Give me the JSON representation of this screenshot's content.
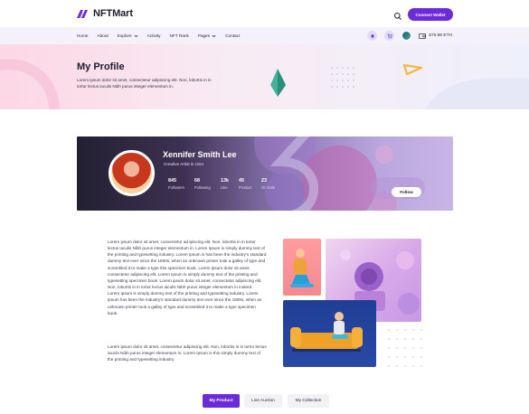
{
  "brand": {
    "name": "NFTMart",
    "accent": "#6c2bd9"
  },
  "header": {
    "connect_label": "Connect Wallet",
    "search_icon": "search-icon"
  },
  "nav": {
    "links": [
      {
        "label": "Home"
      },
      {
        "label": "About"
      },
      {
        "label": "Explore",
        "dropdown": true
      },
      {
        "label": "Activity"
      },
      {
        "label": "NFT Rank"
      },
      {
        "label": "Pages",
        "dropdown": true
      },
      {
        "label": "Contact"
      }
    ],
    "balance": "675.86 ETH"
  },
  "hero": {
    "title": "My Profile",
    "description": "Lorem ipsum dolor sit amet, consectetur adipiscing elit. Non, lobortis in in tortor lectus iaculis Nibh purus integer elementum in."
  },
  "profile": {
    "name": "Xennifer Smith Lee",
    "role": "Creative Artist in USA",
    "stats": [
      {
        "value": "845",
        "label": "Followers"
      },
      {
        "value": "68",
        "label": "Following"
      },
      {
        "value": "13k",
        "label": "Like"
      },
      {
        "value": "45",
        "label": "Product"
      },
      {
        "value": "23",
        "label": "On Sale"
      }
    ],
    "follow_label": "Follow"
  },
  "content": {
    "paragraph1": "Lorem ipsum dolor sit amet, consectetur ad-ipiscing elit. Non, lobortis in in tortor lectus iaculis Nibh purus integer elementum in. Lorem Ipsum is simply dummy text of the printing and typesetting industry. Lorem Ipsum is has been the industry's standard dummy text ever since the 1500s, when an unknown printer took a galley of type and scrambled it to make a type this specimen book. Lorem ipsum dolor sit amet, consectetur adipiscing elit. Lorem Ipsum is simply dummy text of the printing and typesetting specimen book. Lorem ipsum dolor sit amet, consectetur adipiscing elit. Non, lobortis in in tortor lectus iaculis Nibh purus integer elementum in indeed . Lorem Ipsum is simply dummy text of the printing and typesetting industry. Lorem Ipsum has been the industry's standard dummy text ever since the 1500s, when an unknown printer took a galley of type and scrambled it to make a type specimen book.",
    "paragraph2": "Lorem ipsum dolor sit amet, consectetur adipiscing elit. Non, lobortis in in tortor lectus iaculis Nibh purus integer elementum in. Lorem Ipsum is this simply dummy text of the printing and typesetting industry."
  },
  "tabs": [
    {
      "label": "My Product",
      "active": true
    },
    {
      "label": "Live Auction",
      "active": false
    },
    {
      "label": "My Collection",
      "active": false
    }
  ]
}
